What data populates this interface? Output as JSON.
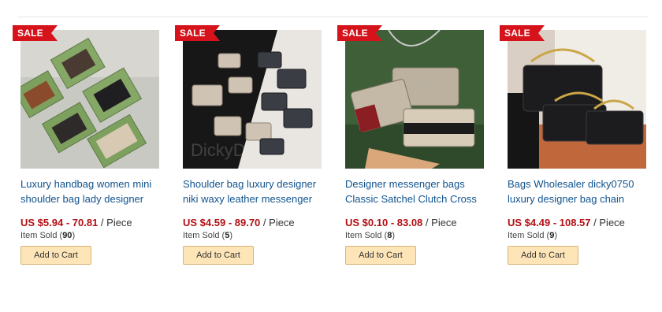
{
  "products": [
    {
      "badge": "SALE",
      "title": "Luxury handbag women mini shoulder bag lady designer",
      "price_range": "US $5.94 - 70.81",
      "unit": "/ Piece",
      "sold_prefix": "Item Sold (",
      "sold_count": "90",
      "sold_suffix": ")",
      "add_to_cart": "Add to Cart"
    },
    {
      "badge": "SALE",
      "title": "Shoulder bag luxury designer niki waxy leather messenger",
      "price_range": "US $4.59 - 89.70",
      "unit": "/ Piece",
      "sold_prefix": "Item Sold (",
      "sold_count": "5",
      "sold_suffix": ")",
      "add_to_cart": "Add to Cart",
      "watermark": "DickyD"
    },
    {
      "badge": "SALE",
      "title": "Designer messenger bags Classic Satchel Clutch Cross",
      "price_range": "US $0.10 - 83.08",
      "unit": "/ Piece",
      "sold_prefix": "Item Sold (",
      "sold_count": "8",
      "sold_suffix": ")",
      "add_to_cart": "Add to Cart"
    },
    {
      "badge": "SALE",
      "title": "Bags Wholesaler dicky0750 luxury designer bag chain",
      "price_range": "US $4.49 - 108.57",
      "unit": "/ Piece",
      "sold_prefix": "Item Sold (",
      "sold_count": "9",
      "sold_suffix": ")",
      "add_to_cart": "Add to Cart"
    }
  ],
  "colors": {
    "sale_badge": "#d6121a",
    "title_link": "#10538e",
    "price": "#b20f14",
    "button_bg": "#fde5b8"
  }
}
